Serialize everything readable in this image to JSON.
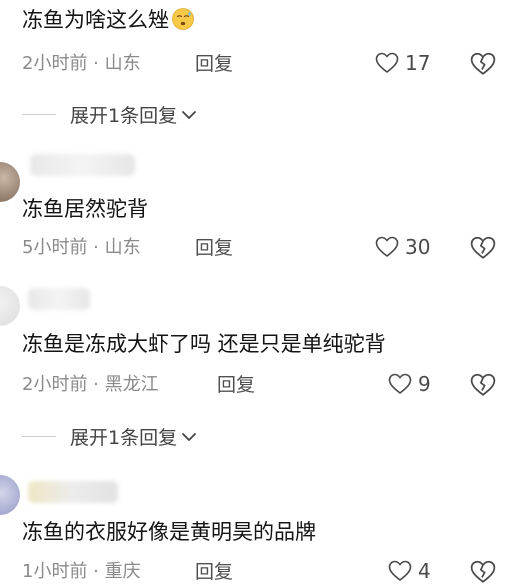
{
  "comments": [
    {
      "text": "冻鱼为啥这么矬",
      "time": "2小时前",
      "location": "山东",
      "reply_label": "回复",
      "likes": "17",
      "expand": "展开1条回复"
    },
    {
      "text": "冻鱼居然驼背",
      "time": "5小时前",
      "location": "山东",
      "reply_label": "回复",
      "likes": "30"
    },
    {
      "text": "冻鱼是冻成大虾了吗  还是只是单纯驼背",
      "time": "2小时前",
      "location": "黑龙江",
      "reply_label": "回复",
      "likes": "9",
      "expand": "展开1条回复"
    },
    {
      "text": "冻鱼的衣服好像是黄明昊的品牌",
      "time": "1小时前",
      "location": "重庆",
      "reply_label": "回复",
      "likes": "4"
    }
  ],
  "meta_separator": " · ",
  "icons": {
    "like": "heart-outline-icon",
    "dislike": "broken-heart-icon",
    "expand": "chevron-down-icon",
    "emoji": "sweat-face-emoji-icon"
  },
  "colors": {
    "text": "#141414",
    "meta": "#8a8a8a",
    "icon": "#4a4a4a"
  }
}
